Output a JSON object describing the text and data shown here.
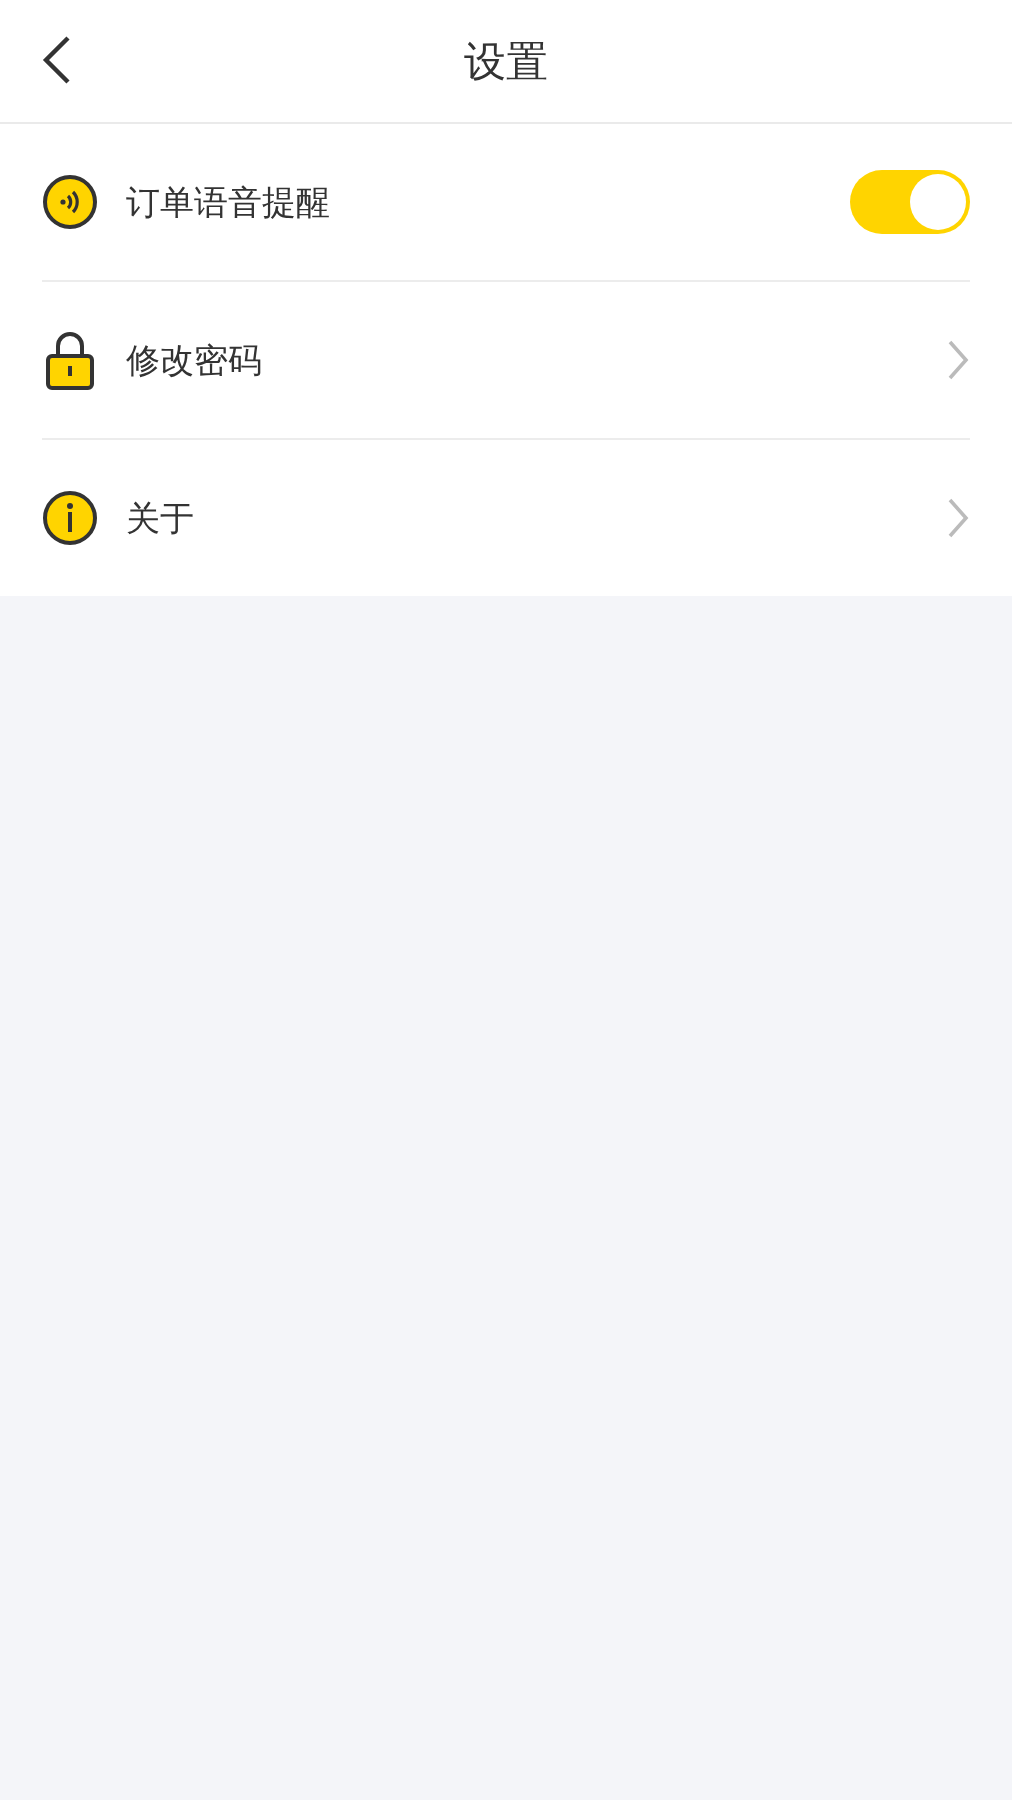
{
  "header": {
    "title": "设置"
  },
  "items": [
    {
      "kind": "toggle",
      "label": "订单语音提醒",
      "on": true
    },
    {
      "kind": "link",
      "label": "修改密码"
    },
    {
      "kind": "link",
      "label": "关于"
    }
  ]
}
